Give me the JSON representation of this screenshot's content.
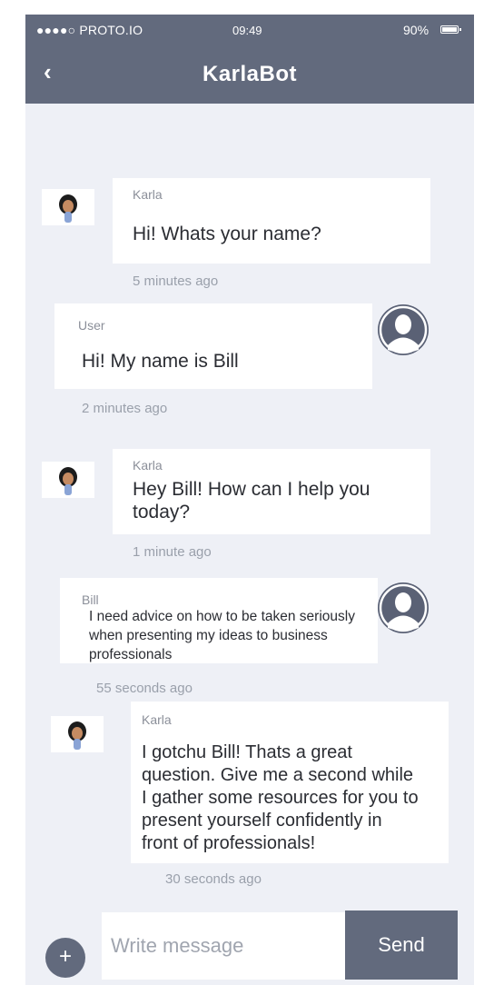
{
  "status_bar": {
    "carrier": "●●●●○ PROTO.IO",
    "time": "09:49",
    "battery": "90%"
  },
  "nav": {
    "back_icon": "‹",
    "title": "KarlaBot"
  },
  "messages": [
    {
      "sender": "Karla",
      "text": "Hi! Whats your name?",
      "time": "5 minutes ago",
      "from": "bot"
    },
    {
      "sender": "User",
      "text": "Hi! My name is Bill",
      "time": "2 minutes ago",
      "from": "user"
    },
    {
      "sender": "Karla",
      "text": "Hey Bill! How can I help you today?",
      "time": "1 minute ago",
      "from": "bot"
    },
    {
      "sender": "Bill",
      "text": "I need advice on how to be taken seriously when presenting my ideas to business professionals",
      "time": "55 seconds ago",
      "from": "user"
    },
    {
      "sender": "Karla",
      "text": "I gotchu Bill! Thats a great question. Give me a second while I gather some resources for you to present yourself confidently in front of professionals!",
      "time": "30 seconds ago",
      "from": "bot"
    }
  ],
  "composer": {
    "plus_label": "+",
    "placeholder": "Write message",
    "send_label": "Send"
  },
  "icons": {
    "bot_avatar": "bot-avatar-icon",
    "user_avatar": "user-avatar-icon",
    "battery": "battery-icon"
  },
  "colors": {
    "header": "#626a7d",
    "background": "#eef0f6",
    "bubble": "#ffffff",
    "button": "#626a7d"
  }
}
